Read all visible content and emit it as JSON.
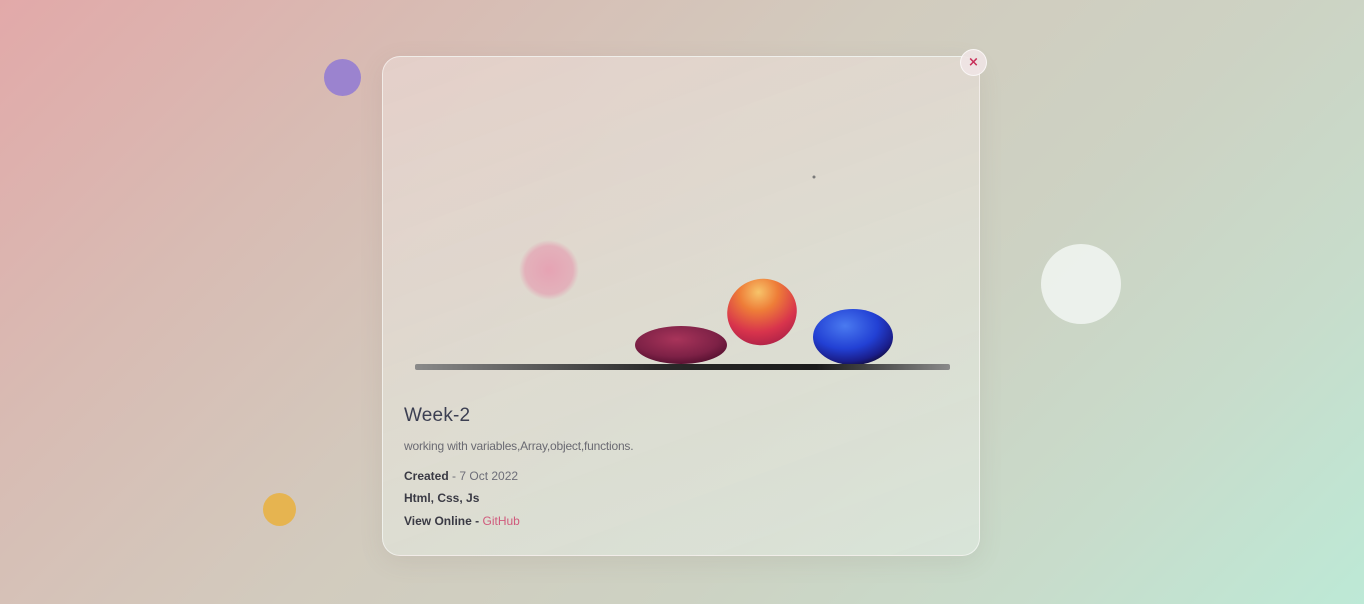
{
  "colors": {
    "accent_link": "#d05a7c",
    "close_icon": "#c8305a",
    "title_text": "#3c3f52"
  },
  "background_blobs": [
    {
      "name": "purple-blob",
      "color": "#9b83cf"
    },
    {
      "name": "yellow-blob",
      "color": "#e6b450"
    },
    {
      "name": "white-blob",
      "color": "#eef2ee"
    }
  ],
  "modal": {
    "close_icon": "×",
    "close_icon_name": "close-icon",
    "preview": {
      "description": "project preview animation: bouncing balls on a bar",
      "balls": [
        {
          "name": "flat-ball",
          "color": "#8e2a4e"
        },
        {
          "name": "orange-ball",
          "color": "#e8743a"
        },
        {
          "name": "blue-ball",
          "color": "#2d4fd8"
        },
        {
          "name": "pink-ball",
          "color": "#e8a0b0"
        }
      ]
    },
    "title": "Week-2",
    "description": "working with variables,Array,object,functions.",
    "created_label": "Created",
    "created_sep": " - ",
    "created_date": "7 Oct 2022",
    "tech": "Html, Css, Js",
    "view_label": "View Online",
    "view_sep": " - ",
    "view_link": "GitHub"
  }
}
